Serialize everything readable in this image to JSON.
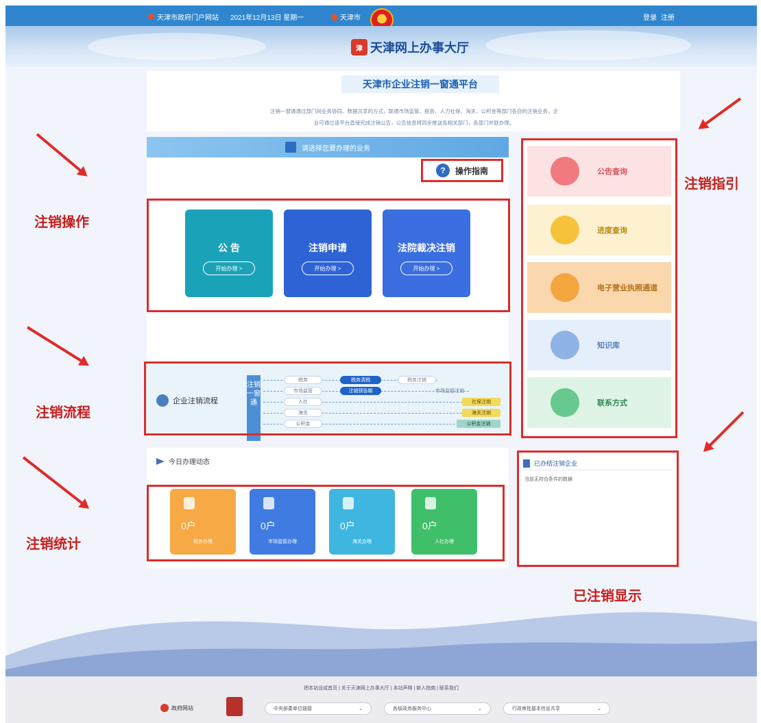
{
  "topbar": {
    "portal": "天津市政府门户网站",
    "date": "2021年12月13日 星期一",
    "city": "天津市",
    "login": "登录",
    "register": "注册"
  },
  "header": {
    "logo_text": "天津网上办事大厅"
  },
  "intro": {
    "title": "天津市企业注销一窗通平台",
    "desc_line1": "注销一窗通通过部门间业务协同、数据共享的方式，联通市场监管、税务、人力社保、海关、公积金等部门各自的注销业务，企",
    "desc_line2": "业可通过该平台直接完成注销公告，公告信息将同步推送各相关部门，各部门并联办理。"
  },
  "business": {
    "header": "请选择您要办理的业务",
    "guide": "操作指南",
    "start_label": "开始办理 >",
    "cards": [
      {
        "title": "公  告",
        "color": "#1aa3b8"
      },
      {
        "title": "注销申请",
        "color": "#2e63d6"
      },
      {
        "title": "法院裁决注销",
        "color": "#3b6ee0"
      }
    ]
  },
  "flow": {
    "title": "企业注销流程",
    "vertical": "注销一窗通",
    "nodes": {
      "tax": "税务",
      "tax_clear": "税务清税",
      "tax_cancel": "税务注销",
      "market": "市场监管",
      "notice": "注销预告期",
      "market_cancel": "市场监管注销",
      "hr": "人社",
      "hr_cancel": "社保注销",
      "customs": "海关",
      "customs_cancel": "海关注销",
      "fund": "公积金",
      "fund_cancel": "公积金注销"
    }
  },
  "stats": {
    "title": "今日办理动态",
    "items": [
      {
        "value": "0户",
        "label": "税务办理",
        "color": "#f6a944"
      },
      {
        "value": "0户",
        "label": "市场监管办理",
        "color": "#3f7be0"
      },
      {
        "value": "0户",
        "label": "海关办理",
        "color": "#3fb6e0"
      },
      {
        "value": "0户",
        "label": "人社办理",
        "color": "#3fbf6a"
      }
    ]
  },
  "side": {
    "items": [
      {
        "label": "公告查询",
        "bg": "#fde2e4",
        "icon": "#f07a7e",
        "text": "#d9555a"
      },
      {
        "label": "进度查询",
        "bg": "#fdf1cf",
        "icon": "#f5c23a",
        "text": "#b88a15"
      },
      {
        "label": "电子营业执照通道",
        "bg": "#fbd7ad",
        "icon": "#f3a63e",
        "text": "#b56f16"
      },
      {
        "label": "知识库",
        "bg": "#e5eefb",
        "icon": "#8fb3e6",
        "text": "#5a7fbf"
      },
      {
        "label": "联系方式",
        "bg": "#dff3e6",
        "icon": "#67c98d",
        "text": "#2f8a55"
      }
    ]
  },
  "done": {
    "title": "已办结注销企业",
    "empty": "当前无符合条件的数据"
  },
  "annotations": {
    "operate": "注销操作",
    "flow": "注销流程",
    "stats": "注销统计",
    "guide": "注销指引",
    "done": "已注销显示"
  },
  "footer": {
    "links": "把本站设成首页 | 关于天津网上办事大厅 | 本站声明 | 新人指南 | 联系我们",
    "gov_site": "政府网站",
    "selects": [
      "中央部委单位链接",
      "各级政务服务中心",
      "行政审批基本信息共享"
    ]
  },
  "colors": {
    "topbar": "#2f86cf",
    "annotation": "#dd2b2b"
  }
}
